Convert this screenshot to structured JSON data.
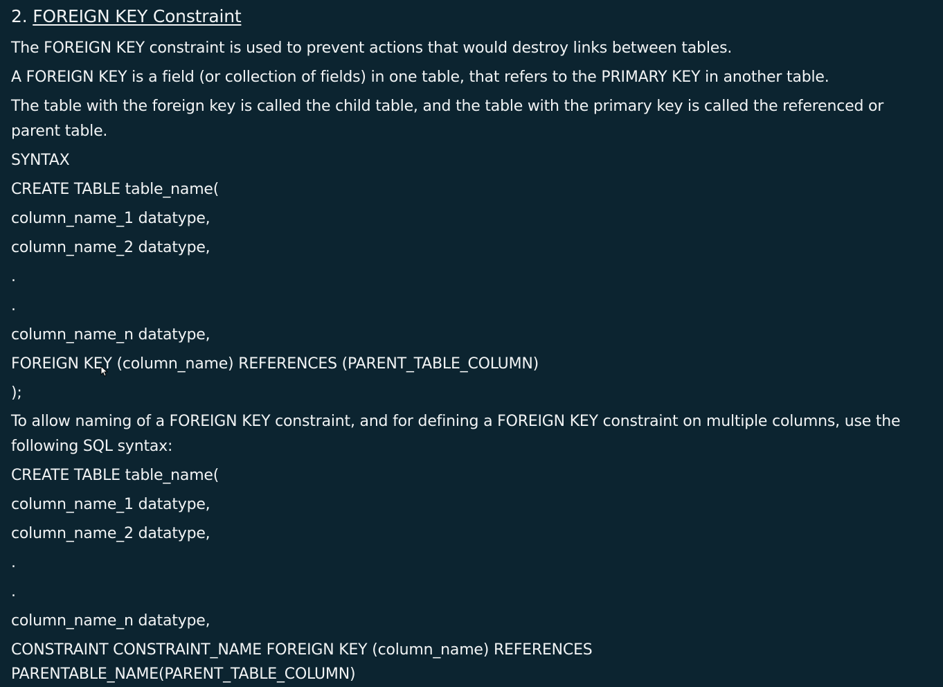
{
  "heading": {
    "number": "2.",
    "title": "FOREIGN KEY Constraint"
  },
  "paragraphs": {
    "p1": "The FOREIGN KEY constraint is used to prevent actions that would destroy links between tables.",
    "p2": "A FOREIGN KEY is a field (or collection of fields) in one table, that refers to the PRIMARY KEY in another table.",
    "p3_line1": "The table with the foreign key is called the child table, and the table with the primary key is called the referenced or",
    "p3_line2": "parent table."
  },
  "syntax_label": "SYNTAX",
  "syntax1": {
    "l1": "CREATE  TABLE table_name(",
    "l2": "column_name_1 datatype,",
    "l3": "column_name_2 datatype,",
    "l4": ".",
    "l5": ".",
    "l6": "column_name_n datatype,",
    "l7": "FOREIGN KEY (column_name) REFERENCES (PARENT_TABLE_COLUMN)",
    "l8": ");"
  },
  "named_intro": {
    "line1": "To allow naming of a FOREIGN KEY constraint, and for defining a FOREIGN KEY constraint on multiple columns, use the",
    "line2": "following SQL syntax:"
  },
  "syntax2": {
    "l1": "CREATE  TABLE table_name(",
    "l2": "column_name_1 datatype,",
    "l3": "column_name_2 datatype,",
    "l4": ".",
    "l5": ".",
    "l6": "column_name_n datatype,",
    "l7": "CONSTRAINT CONSTRAINT_NAME FOREIGN KEY (column_name) REFERENCES",
    "l8": "PARENTABLE_NAME(PARENT_TABLE_COLUMN)"
  }
}
